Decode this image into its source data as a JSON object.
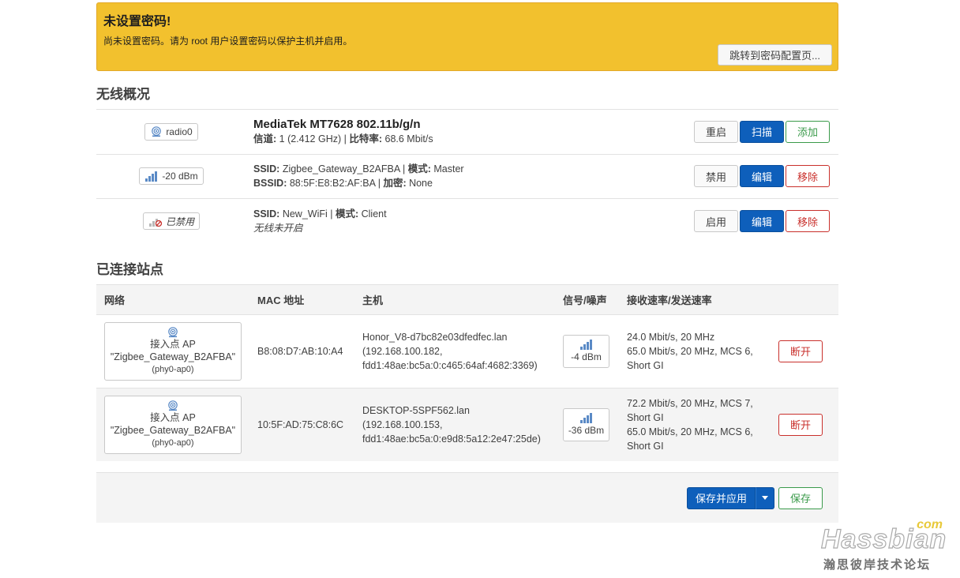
{
  "alert": {
    "title": "未设置密码!",
    "message": "尚未设置密码。请为 root 用户设置密码以保护主机并启用。",
    "goto_label": "跳转到密码配置页..."
  },
  "wireless": {
    "heading": "无线概况",
    "radio": {
      "badge": "radio0",
      "title": "MediaTek MT7628 802.11b/g/n",
      "channel_label": "信道:",
      "channel_value": " 1 (2.412 GHz) | ",
      "bitrate_label": "比特率:",
      "bitrate_value": " 68.6 Mbit/s",
      "buttons": {
        "restart": "重启",
        "scan": "扫描",
        "add": "添加"
      }
    },
    "networks": [
      {
        "badge": "-20 dBm",
        "ssid_label": "SSID:",
        "ssid_value": " Zigbee_Gateway_B2AFBA | ",
        "mode_label": "模式:",
        "mode_value": " Master",
        "bssid_label": "BSSID:",
        "bssid_value": " 88:5F:E8:B2:AF:BA | ",
        "enc_label": "加密:",
        "enc_value": " None",
        "buttons": {
          "toggle": "禁用",
          "edit": "编辑",
          "remove": "移除"
        }
      },
      {
        "badge": "已禁用",
        "ssid_label": "SSID:",
        "ssid_value": " New_WiFi | ",
        "mode_label": "模式:",
        "mode_value": " Client",
        "status": "无线未开启",
        "buttons": {
          "toggle": "启用",
          "edit": "编辑",
          "remove": "移除"
        }
      }
    ]
  },
  "stations": {
    "heading": "已连接站点",
    "columns": [
      "网络",
      "MAC 地址",
      "主机",
      "信号/噪声",
      "接收速率/发送速率"
    ],
    "rows": [
      {
        "net_line1": "接入点 AP",
        "net_line2": "\"Zigbee_Gateway_B2AFBA\"",
        "net_line3": "(phy0-ap0)",
        "mac": "B8:08:D7:AB:10:A4",
        "host_line1": "Honor_V8-d7bc82e03dfedfec.lan",
        "host_line2": "(192.168.100.182,",
        "host_line3": "fdd1:48ae:bc5a:0:c465:64af:4682:3369)",
        "signal": "-4 dBm",
        "rate_lines": [
          "24.0 Mbit/s, 20 MHz",
          "65.0 Mbit/s, 20 MHz, MCS 6,",
          "Short GI"
        ],
        "disconnect": "断开"
      },
      {
        "net_line1": "接入点 AP",
        "net_line2": "\"Zigbee_Gateway_B2AFBA\"",
        "net_line3": "(phy0-ap0)",
        "mac": "10:5F:AD:75:C8:6C",
        "host_line1": "DESKTOP-5SPF562.lan",
        "host_line2": "(192.168.100.153,",
        "host_line3": "fdd1:48ae:bc5a:0:e9d8:5a12:2e47:25de)",
        "signal": "-36 dBm",
        "rate_lines": [
          "72.2 Mbit/s, 20 MHz, MCS 7,",
          "Short GI",
          "65.0 Mbit/s, 20 MHz, MCS 6,",
          "Short GI"
        ],
        "disconnect": "断开"
      }
    ]
  },
  "footer": {
    "save_apply": "保存并应用",
    "save": "保存"
  },
  "watermark": {
    "brand": "Hassbian",
    "suffix": "com",
    "subtitle": "瀚思彼岸技术论坛"
  },
  "colors": {
    "alert_bg": "#f2c12e",
    "primary": "#0e5fbb",
    "positive": "#3a9a4a",
    "negative": "#c9302c"
  },
  "icons": {
    "radio": "wifi-antenna-icon",
    "signal": "signal-bars-icon",
    "disabled": "wifi-disabled-icon",
    "caret": "caret-down-icon"
  }
}
